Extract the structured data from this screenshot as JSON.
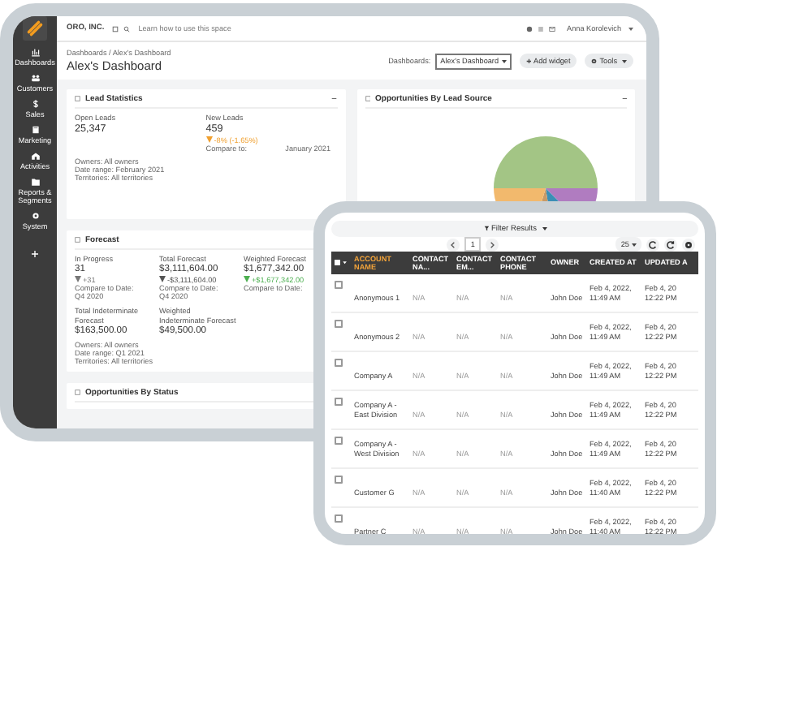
{
  "dashboard_window": {
    "sidebar": [
      {
        "label": "Dashboards"
      },
      {
        "label": "Customers"
      },
      {
        "label": "Sales"
      },
      {
        "label": "Marketing"
      },
      {
        "label": "Activities"
      },
      {
        "label": "Reports & Segments"
      },
      {
        "label": "System"
      }
    ],
    "company": "ORO, INC.",
    "help_text": "Learn how to use this space",
    "user": "Anna Korolevich",
    "breadcrumb": "Dashboards / Alex's Dashboard",
    "title": "Alex's Dashboard",
    "dashboard_label": "Dashboards:",
    "dashboard_select": "Alex's Dashboard",
    "add_widget_button": "Add widget",
    "tools_button": "Tools",
    "lead_statistics": {
      "title": "Lead Statistics",
      "metrics": [
        {
          "label": "Open Leads",
          "value": "25,347"
        },
        {
          "label": "New Leads",
          "value": "459",
          "change": "-8% (-1.65%)",
          "color": "#f0a030",
          "compare_label": "Compare to:",
          "compare_value": "January 2021"
        }
      ],
      "filters": [
        "Owners: All owners",
        "Date range: February 2021",
        "Territories: All territories"
      ]
    },
    "lead_source": {
      "title": "Opportunities By Lead Source"
    },
    "forecast": {
      "title": "Forecast",
      "metrics": [
        {
          "label": "In Progress",
          "value": "31",
          "change": "+31",
          "color": "#777777",
          "compare_label": "Compare to Date:",
          "compare_value": "Q4 2020"
        },
        {
          "label": "Total Forecast",
          "value": "$3,111,604.00",
          "change": "-$3,111,604.00",
          "color": "#555555",
          "compare_label": "Compare to Date:",
          "compare_value": "Q4 2020"
        },
        {
          "label": "Weighted Forecast",
          "value": "$1,677,342.00",
          "change": "+$1,677,342.00",
          "color": "#4caf50",
          "compare_label": "Compare to Date:"
        }
      ],
      "indeterminate": [
        {
          "label": "Total Indeterminate Forecast",
          "value": "$163,500.00"
        },
        {
          "label": "Weighted Indeterminate Forecast",
          "value": "$49,500.00"
        }
      ],
      "filters": [
        "Owners: All owners",
        "Date range: Q1 2021",
        "Territories: All territories"
      ]
    },
    "status_widget": {
      "title": "Opportunities By Status"
    }
  },
  "grid_window": {
    "filter": "Filter Results",
    "page": "1",
    "page_size": "25",
    "all_selected": false,
    "columns": [
      {
        "label": "ACCOUNT NAME",
        "sorted": true
      },
      {
        "label": "CONTACT NA...",
        "sorted": false
      },
      {
        "label": "CONTACT EM...",
        "sorted": false
      },
      {
        "label": "CONTACT PHONE",
        "sorted": false
      },
      {
        "label": "OWNER",
        "sorted": false
      },
      {
        "label": "CREATED AT",
        "sorted": false
      },
      {
        "label": "UPDATED A",
        "sorted": false
      }
    ],
    "rows": [
      {
        "checked": false,
        "cells": [
          [
            "Anonymous 1"
          ],
          [
            "N/A"
          ],
          [
            "N/A"
          ],
          [
            "N/A"
          ],
          [
            "John Doe"
          ],
          [
            "Feb 4, 2022,",
            "11:49 AM"
          ],
          [
            "Feb 4, 20",
            "12:22 PM"
          ]
        ]
      },
      {
        "checked": false,
        "cells": [
          [
            "Anonymous 2"
          ],
          [
            "N/A"
          ],
          [
            "N/A"
          ],
          [
            "N/A"
          ],
          [
            "John Doe"
          ],
          [
            "Feb 4, 2022,",
            "11:49 AM"
          ],
          [
            "Feb 4, 20",
            "12:22 PM"
          ]
        ]
      },
      {
        "checked": false,
        "cells": [
          [
            "Company A"
          ],
          [
            "N/A"
          ],
          [
            "N/A"
          ],
          [
            "N/A"
          ],
          [
            "John Doe"
          ],
          [
            "Feb 4, 2022,",
            "11:49 AM"
          ],
          [
            "Feb 4, 20",
            "12:22 PM"
          ]
        ]
      },
      {
        "checked": false,
        "cells": [
          [
            "Company A -",
            "East Division"
          ],
          [
            "N/A"
          ],
          [
            "N/A"
          ],
          [
            "N/A"
          ],
          [
            "John Doe"
          ],
          [
            "Feb 4, 2022,",
            "11:49 AM"
          ],
          [
            "Feb 4, 20",
            "12:22 PM"
          ]
        ]
      },
      {
        "checked": false,
        "cells": [
          [
            "Company A -",
            "West Division"
          ],
          [
            "N/A"
          ],
          [
            "N/A"
          ],
          [
            "N/A"
          ],
          [
            "John Doe"
          ],
          [
            "Feb 4, 2022,",
            "11:49 AM"
          ],
          [
            "Feb 4, 20",
            "12:22 PM"
          ]
        ]
      },
      {
        "checked": false,
        "cells": [
          [
            "Customer G"
          ],
          [
            "N/A"
          ],
          [
            "N/A"
          ],
          [
            "N/A"
          ],
          [
            "John Doe"
          ],
          [
            "Feb 4, 2022,",
            "11:40 AM"
          ],
          [
            "Feb 4, 20",
            "12:22 PM"
          ]
        ]
      },
      {
        "checked": false,
        "cells": [
          [
            "Partner C"
          ],
          [
            "N/A"
          ],
          [
            "N/A"
          ],
          [
            "N/A"
          ],
          [
            "John Doe"
          ],
          [
            "Feb 4, 2022,",
            "11:40 AM"
          ],
          [
            "Feb 4, 20",
            "12:22 PM"
          ]
        ]
      }
    ]
  }
}
